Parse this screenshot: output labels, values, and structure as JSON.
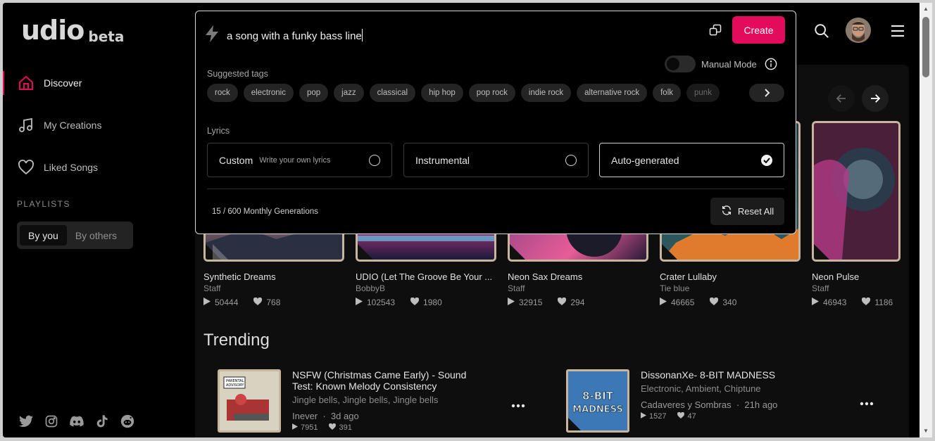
{
  "brand": {
    "logo": "udio",
    "badge": "beta"
  },
  "sidebar": {
    "items": [
      {
        "label": "Discover",
        "icon": "home-icon"
      },
      {
        "label": "My Creations",
        "icon": "music-note-icon"
      },
      {
        "label": "Liked Songs",
        "icon": "heart-icon"
      }
    ],
    "playlists_title": "PLAYLISTS",
    "playlist_tabs": [
      "By you",
      "By others"
    ],
    "socials": [
      "twitter-icon",
      "instagram-icon",
      "discord-icon",
      "tiktok-icon",
      "reddit-icon"
    ]
  },
  "create_panel": {
    "prompt": "a song with a funky bass line",
    "create_label": "Create",
    "manual_mode_label": "Manual Mode",
    "suggested_tags_title": "Suggested tags",
    "tags": [
      "rock",
      "electronic",
      "pop",
      "jazz",
      "classical",
      "hip hop",
      "pop rock",
      "indie rock",
      "alternative rock",
      "folk",
      "punk"
    ],
    "lyrics_title": "Lyrics",
    "lyrics_options": [
      {
        "label": "Custom",
        "sub": "Write your own lyrics",
        "selected": false
      },
      {
        "label": "Instrumental",
        "sub": "",
        "selected": false
      },
      {
        "label": "Auto-generated",
        "sub": "",
        "selected": true
      }
    ],
    "generations": "15 / 600 Monthly Generations",
    "reset_label": "Reset All"
  },
  "cards": [
    {
      "title": "Synthetic Dreams",
      "artist": "Staff",
      "plays": "50444",
      "likes": "768"
    },
    {
      "title": "UDIO (Let The Groove Be Your ...",
      "artist": "BobbyB",
      "plays": "102543",
      "likes": "1980"
    },
    {
      "title": "Neon Sax Dreams",
      "artist": "Staff",
      "plays": "32915",
      "likes": "294"
    },
    {
      "title": "Crater Lullaby",
      "artist": "Tie blue",
      "plays": "46665",
      "likes": "340"
    },
    {
      "title": "Neon Pulse",
      "artist": "Staff",
      "plays": "46943",
      "likes": "1186"
    }
  ],
  "trending": {
    "title": "Trending",
    "tracks": [
      {
        "name": "NSFW (Christmas Came Early) - Sound Test: Known Melody Consistency",
        "tags": "Jingle bells, Jingle bells, Jingle bells",
        "artist": "Inever",
        "when": "3d ago",
        "plays": "7951",
        "likes": "391"
      },
      {
        "name": "DissonanXe- 8-BIT MADNESS",
        "tags": "Electronic, Ambient, Chiptune",
        "artist": "Cadaveres y Sombras",
        "when": "21h ago",
        "plays": "1527",
        "likes": "47",
        "art_text": "8-BIT MADNESS"
      }
    ]
  },
  "colors": {
    "accent": "#e30b5c",
    "background": "#000000",
    "card_border": "#c7b59e"
  }
}
